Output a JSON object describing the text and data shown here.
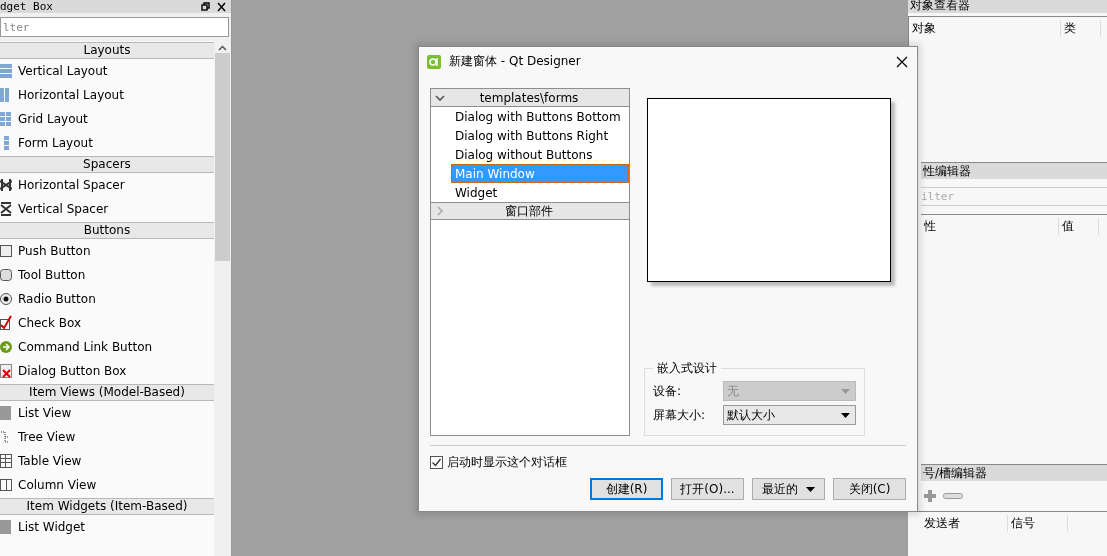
{
  "widget_box": {
    "title": "dget Box",
    "filter_placeholder": "lter",
    "categories": [
      {
        "name": "Layouts",
        "items": [
          "Vertical Layout",
          "Horizontal Layout",
          "Grid Layout",
          "Form Layout"
        ]
      },
      {
        "name": "Spacers",
        "items": [
          "Horizontal Spacer",
          "Vertical Spacer"
        ]
      },
      {
        "name": "Buttons",
        "items": [
          "Push Button",
          "Tool Button",
          "Radio Button",
          "Check Box",
          "Command Link Button",
          "Dialog Button Box"
        ]
      },
      {
        "name": "Item Views (Model-Based)",
        "items": [
          "List View",
          "Tree View",
          "Table View",
          "Column View"
        ]
      },
      {
        "name": "Item Widgets (Item-Based)",
        "items": [
          "List Widget"
        ]
      }
    ]
  },
  "dialog": {
    "title": "新建窗体 - Qt Designer",
    "template_tree": [
      {
        "label": "templates\\forms",
        "expanded": true,
        "children": [
          {
            "label": "Dialog with Buttons Bottom",
            "selected": false
          },
          {
            "label": "Dialog with Buttons Right",
            "selected": false
          },
          {
            "label": "Dialog without Buttons",
            "selected": false
          },
          {
            "label": "Main Window",
            "selected": true
          },
          {
            "label": "Widget",
            "selected": false
          }
        ]
      },
      {
        "label": "窗口部件",
        "expanded": false
      }
    ],
    "embedded_design": {
      "title": "嵌入式设计",
      "fields": [
        {
          "label": "设备:",
          "value": "无",
          "disabled": true
        },
        {
          "label": "屏幕大小:",
          "value": "默认大小",
          "disabled": false
        }
      ]
    },
    "show_on_startup": {
      "label": "启动时显示这个对话框",
      "checked": true
    },
    "buttons": [
      {
        "label": "创建(R)",
        "kind": "default"
      },
      {
        "label": "打开(O)...",
        "kind": "plain"
      },
      {
        "label": "最近的",
        "kind": "menu"
      },
      {
        "label": "关闭(C)",
        "kind": "plain"
      }
    ]
  },
  "object_inspector": {
    "title": "对象查看器",
    "columns": [
      "对象",
      "类"
    ]
  },
  "property_editor": {
    "title": "性编辑器",
    "filter_placeholder": "ilter",
    "columns": [
      "性",
      "值"
    ]
  },
  "signal_slot_editor": {
    "title": "号/槽编辑器",
    "columns": [
      "发送者",
      "信号"
    ]
  }
}
